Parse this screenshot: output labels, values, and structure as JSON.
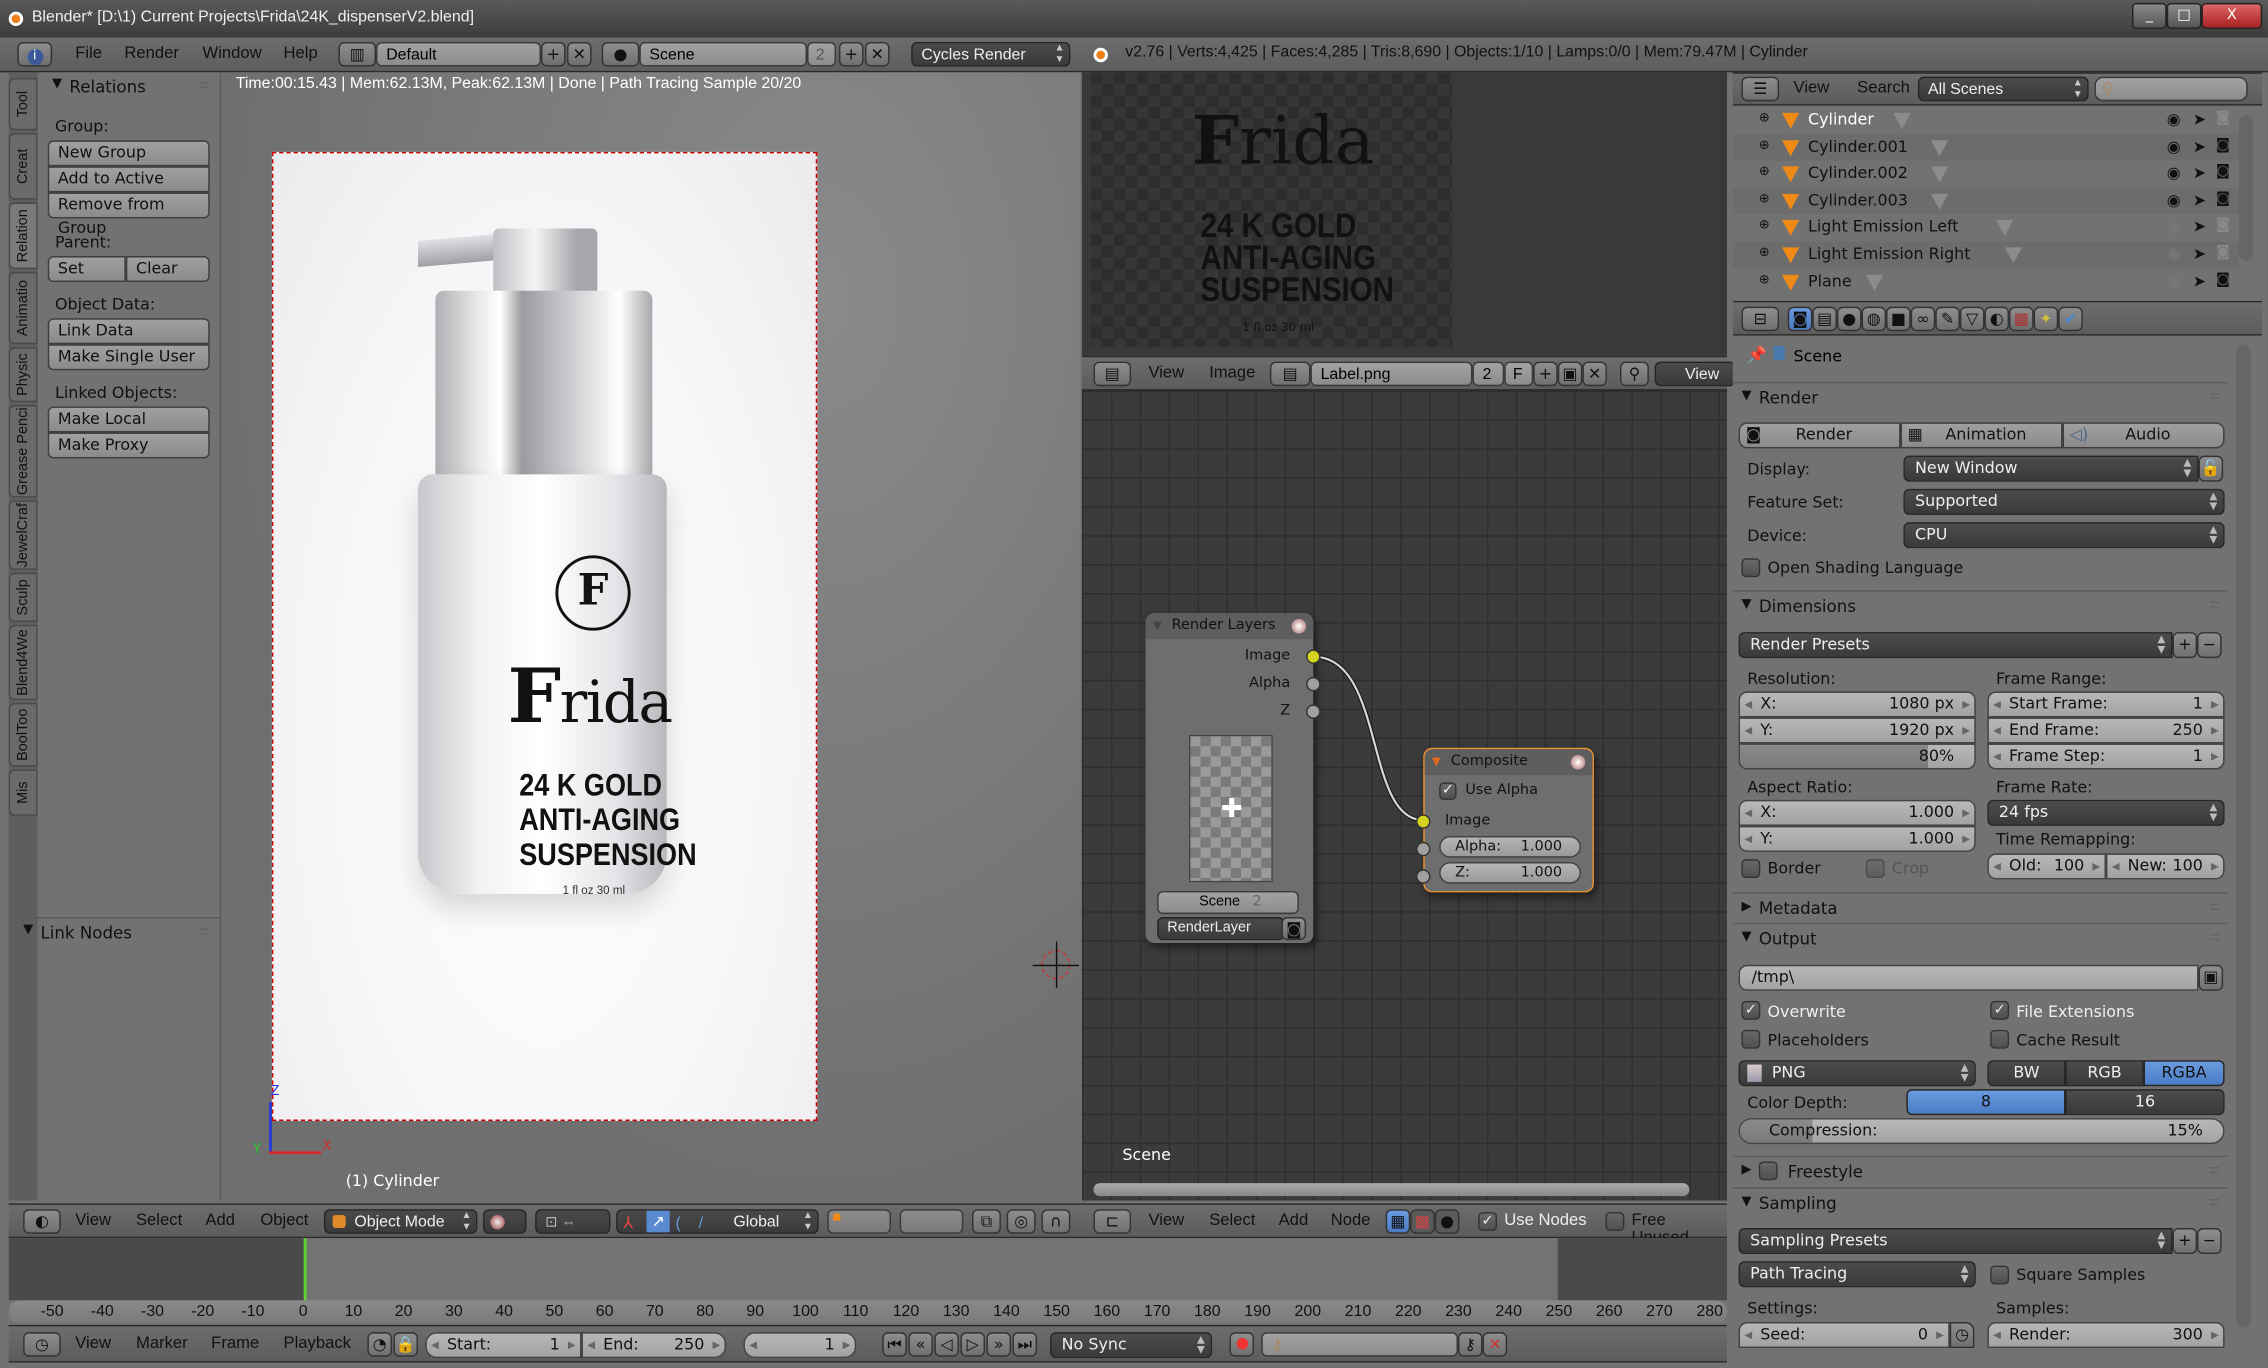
{
  "window": {
    "title": "Blender* [D:\\1) Current Projects\\Frida\\24K_dispenserV2.blend]",
    "controls": {
      "minimize": "_",
      "maximize": "□",
      "close": "X"
    }
  },
  "info_header": {
    "menus": [
      "File",
      "Render",
      "Window",
      "Help"
    ],
    "layout": "Default",
    "scene": "Scene",
    "scene_users": "2",
    "engine": "Cycles Render",
    "stats": "v2.76 | Verts:4,425 | Faces:4,285 | Tris:8,690 | Objects:1/10 | Lamps:0/0 | Mem:79.47M | Cylinder"
  },
  "tool_tabs": [
    "Tool",
    "Creat",
    "Relation",
    "Animatio",
    "Physic",
    "Grease Penci",
    "JewelCraf",
    "Sculp",
    "Blend4We",
    "BoolToo",
    "Mis"
  ],
  "active_tab": "Relation",
  "relations_panel": {
    "title": "Relations",
    "group_label": "Group:",
    "group_buttons": [
      "New Group",
      "Add to Active",
      "Remove from Group"
    ],
    "parent_label": "Parent:",
    "parent_buttons": [
      "Set",
      "Clear"
    ],
    "object_data_label": "Object Data:",
    "object_data_buttons": [
      "Link Data",
      "Make Single User"
    ],
    "linked_label": "Linked Objects:",
    "linked_buttons": [
      "Make Local",
      "Make Proxy"
    ],
    "link_nodes_title": "Link Nodes"
  },
  "viewport": {
    "status": "Time:00:15.43 | Mem:62.13M, Peak:62.13M | Done | Path Tracing Sample 20/20",
    "object_label": "(1) Cylinder",
    "axes": {
      "z": "Z",
      "x": "X",
      "y": "Y"
    },
    "render_label": {
      "brand": "rida",
      "brand_initial": "F",
      "logo": "F",
      "lines": [
        "24 K GOLD",
        "ANTI-AGING",
        "SUSPENSION"
      ],
      "size": "1 fl oz 30 ml"
    },
    "header": {
      "menus": [
        "View",
        "Select",
        "Add",
        "Object"
      ],
      "mode": "Object Mode",
      "orientation": "Global"
    }
  },
  "image_editor": {
    "menus": [
      "View",
      "Image"
    ],
    "image_name": "Label.png",
    "users": "2",
    "fake": "F",
    "view_label": "View"
  },
  "node_editor": {
    "scene_label": "Scene",
    "render_layers": {
      "title": "Render Layers",
      "outputs": [
        "Image",
        "Alpha",
        "Z"
      ],
      "scene": "Scene",
      "scene_users": "2",
      "layer": "RenderLayer"
    },
    "composite": {
      "title": "Composite",
      "use_alpha_label": "Use Alpha",
      "use_alpha": true,
      "image_input": "Image",
      "alpha_label": "Alpha:",
      "alpha_value": "1.000",
      "z_label": "Z:",
      "z_value": "1.000"
    },
    "header": {
      "menus": [
        "View",
        "Select",
        "Add",
        "Node"
      ],
      "use_nodes_label": "Use Nodes",
      "use_nodes": true,
      "free_unused_label": "Free Unused",
      "free_unused": false
    }
  },
  "outliner": {
    "menus": [
      "View",
      "Search"
    ],
    "filter": "All Scenes",
    "search_placeholder": "",
    "rows": [
      {
        "name": "Cylinder",
        "visible": true,
        "renderable": false,
        "active": true
      },
      {
        "name": "Cylinder.001",
        "visible": true,
        "renderable": true
      },
      {
        "name": "Cylinder.002",
        "visible": true,
        "renderable": true
      },
      {
        "name": "Cylinder.003",
        "visible": true,
        "renderable": true
      },
      {
        "name": "Light Emission Left",
        "visible": false,
        "renderable": false
      },
      {
        "name": "Light Emission Right",
        "visible": false,
        "renderable": false
      },
      {
        "name": "Plane",
        "visible": false,
        "renderable": true
      }
    ]
  },
  "properties": {
    "context_path": "Scene",
    "render": {
      "title": "Render",
      "buttons": [
        "Render",
        "Animation",
        "Audio"
      ],
      "display_label": "Display:",
      "display": "New Window",
      "feature_set_label": "Feature Set:",
      "feature_set": "Supported",
      "device_label": "Device:",
      "device": "CPU",
      "osl_label": "Open Shading Language",
      "osl": false
    },
    "dimensions": {
      "title": "Dimensions",
      "presets": "Render Presets",
      "resolution_label": "Resolution:",
      "res_x_label": "X:",
      "res_x": "1080 px",
      "res_y_label": "Y:",
      "res_y": "1920 px",
      "res_percent": "80%",
      "res_percent_value": 0.8,
      "frame_range_label": "Frame Range:",
      "start_label": "Start Frame:",
      "start": "1",
      "end_label": "End Frame:",
      "end": "250",
      "step_label": "Frame Step:",
      "step": "1",
      "aspect_label": "Aspect Ratio:",
      "aspect_x_label": "X:",
      "aspect_x": "1.000",
      "aspect_y_label": "Y:",
      "aspect_y": "1.000",
      "frame_rate_label": "Frame Rate:",
      "frame_rate": "24 fps",
      "time_remap_label": "Time Remapping:",
      "old_label": "Old:",
      "old": "100",
      "new_label": "New:",
      "new": "100",
      "border_label": "Border",
      "border": false,
      "crop_label": "Crop",
      "crop": false
    },
    "metadata": {
      "title": "Metadata"
    },
    "output": {
      "title": "Output",
      "path": "/tmp\\",
      "overwrite_label": "Overwrite",
      "overwrite": true,
      "file_ext_label": "File Extensions",
      "file_ext": true,
      "placeholders_label": "Placeholders",
      "placeholders": false,
      "cache_label": "Cache Result",
      "cache": false,
      "format": "PNG",
      "color_modes": [
        "BW",
        "RGB",
        "RGBA"
      ],
      "color_mode": "RGBA",
      "depth_label": "Color Depth:",
      "depths": [
        "8",
        "16"
      ],
      "depth": "8",
      "compression_label": "Compression:",
      "compression": "15%",
      "compression_value": 0.15
    },
    "freestyle": {
      "title": "Freestyle",
      "enabled": false
    },
    "sampling": {
      "title": "Sampling",
      "presets": "Sampling Presets",
      "integrator": "Path Tracing",
      "square_label": "Square Samples",
      "square": false,
      "settings_label": "Settings:",
      "seed_label": "Seed:",
      "seed": "0",
      "samples_label": "Samples:",
      "render_label": "Render:",
      "render_samples": "300"
    }
  },
  "timeline": {
    "ticks": [
      "-50",
      "-40",
      "-30",
      "-20",
      "-10",
      "0",
      "10",
      "20",
      "30",
      "40",
      "50",
      "60",
      "70",
      "80",
      "90",
      "100",
      "110",
      "120",
      "130",
      "140",
      "150",
      "160",
      "170",
      "180",
      "190",
      "200",
      "210",
      "220",
      "230",
      "240",
      "250",
      "260",
      "270",
      "280"
    ],
    "current_frame": "1",
    "menus": [
      "View",
      "Marker",
      "Frame",
      "Playback"
    ],
    "start_label": "Start:",
    "start": "1",
    "end_label": "End:",
    "end": "250",
    "sync": "No Sync"
  }
}
